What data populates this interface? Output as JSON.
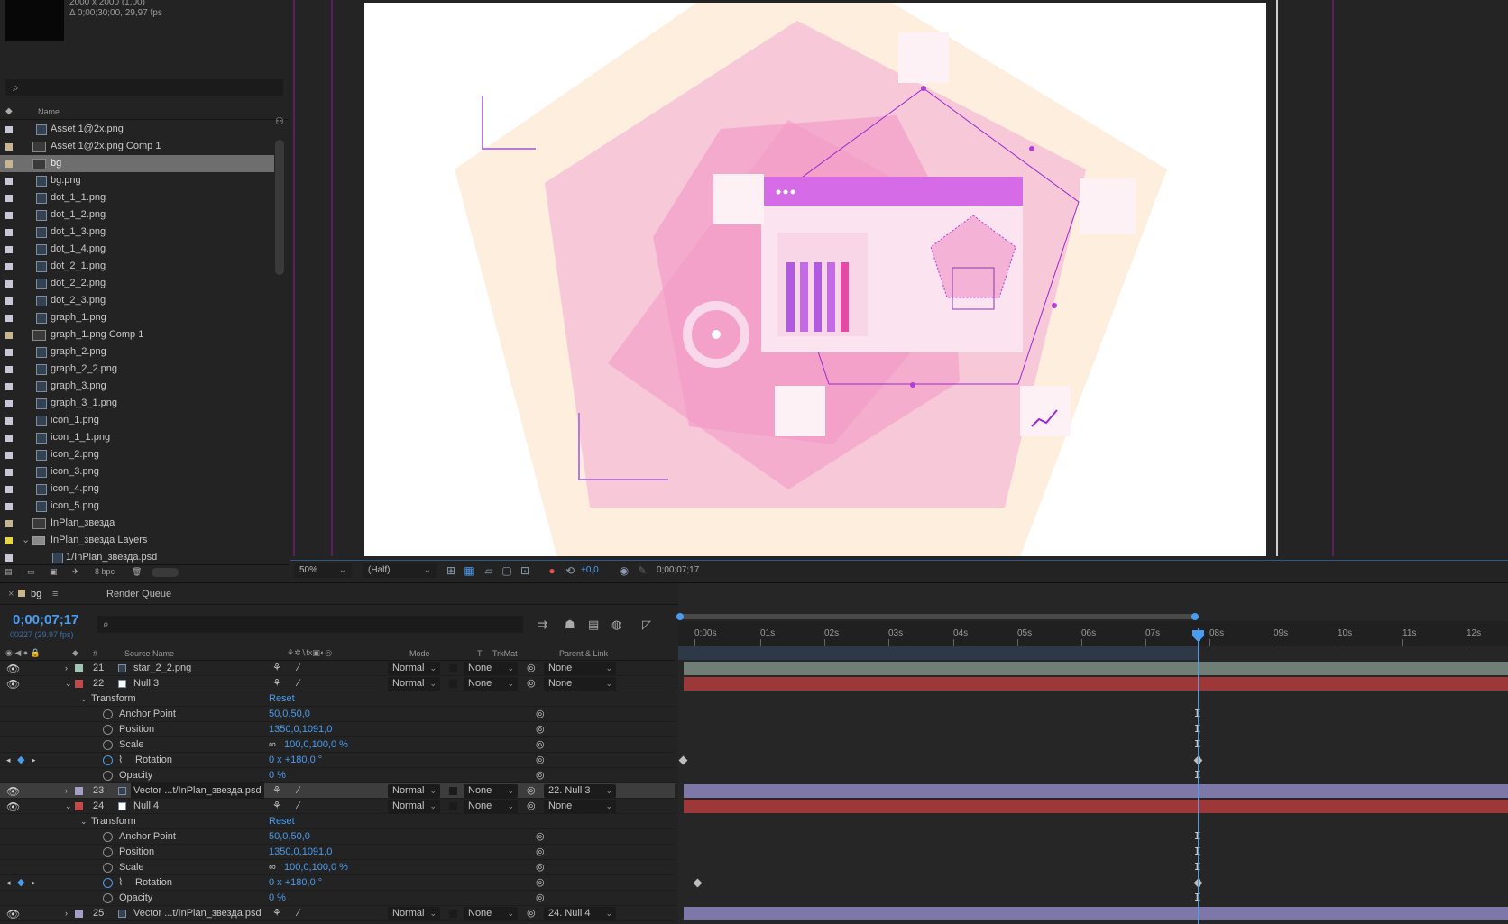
{
  "project": {
    "meta_line1": "2000 x 2000 (1,00)",
    "meta_line2": "Δ 0;00;30;00, 29,97 fps",
    "search_placeholder": "",
    "name_header": "Name",
    "bpc": "8 bpc",
    "items": [
      {
        "name": "Asset 1@2x.png",
        "type": "file",
        "label": "#c7c7d8"
      },
      {
        "name": "Asset 1@2x.png Comp 1",
        "type": "comp",
        "label": "#c8b48e"
      },
      {
        "name": "bg",
        "type": "comp",
        "label": "#c8b48e",
        "selected": true
      },
      {
        "name": "bg.png",
        "type": "file",
        "label": "#c7c7d8"
      },
      {
        "name": "dot_1_1.png",
        "type": "file",
        "label": "#c7c7d8"
      },
      {
        "name": "dot_1_2.png",
        "type": "file",
        "label": "#c7c7d8"
      },
      {
        "name": "dot_1_3.png",
        "type": "file",
        "label": "#c7c7d8"
      },
      {
        "name": "dot_1_4.png",
        "type": "file",
        "label": "#c7c7d8"
      },
      {
        "name": "dot_2_1.png",
        "type": "file",
        "label": "#c7c7d8"
      },
      {
        "name": "dot_2_2.png",
        "type": "file",
        "label": "#c7c7d8"
      },
      {
        "name": "dot_2_3.png",
        "type": "file",
        "label": "#c7c7d8"
      },
      {
        "name": "graph_1.png",
        "type": "file",
        "label": "#c7c7d8"
      },
      {
        "name": "graph_1.png Comp 1",
        "type": "comp",
        "label": "#c8b48e"
      },
      {
        "name": "graph_2.png",
        "type": "file",
        "label": "#c7c7d8"
      },
      {
        "name": "graph_2_2.png",
        "type": "file",
        "label": "#c7c7d8"
      },
      {
        "name": "graph_3.png",
        "type": "file",
        "label": "#c7c7d8"
      },
      {
        "name": "graph_3_1.png",
        "type": "file",
        "label": "#c7c7d8"
      },
      {
        "name": "icon_1.png",
        "type": "file",
        "label": "#c7c7d8"
      },
      {
        "name": "icon_1_1.png",
        "type": "file",
        "label": "#c7c7d8"
      },
      {
        "name": "icon_2.png",
        "type": "file",
        "label": "#c7c7d8"
      },
      {
        "name": "icon_3.png",
        "type": "file",
        "label": "#c7c7d8"
      },
      {
        "name": "icon_4.png",
        "type": "file",
        "label": "#c7c7d8"
      },
      {
        "name": "icon_5.png",
        "type": "file",
        "label": "#c7c7d8"
      },
      {
        "name": "InPlan_звезда",
        "type": "comp",
        "label": "#c8b48e"
      },
      {
        "name": "InPlan_звезда Layers",
        "type": "folder",
        "label": "#e6d44a"
      },
      {
        "name": "1/InPlan_звезда.psd",
        "type": "file",
        "label": "#c7c7d8",
        "indent": true
      }
    ]
  },
  "viewer": {
    "zoom": "50%",
    "resolution": "(Half)",
    "exposure": "+0,0",
    "timecode": "0;00;07;17"
  },
  "timeline": {
    "tab_comp": "bg",
    "tab_render": "Render Queue",
    "timecode": "0;00;07;17",
    "frames": "00227 (29.97 fps)",
    "col_num": "#",
    "col_source": "Source Name",
    "col_mode": "Mode",
    "col_t": "T",
    "col_trkmat": "TrkMat",
    "col_parent": "Parent & Link",
    "ruler": [
      "0:00s",
      "01s",
      "02s",
      "03s",
      "04s",
      "05s",
      "06s",
      "07s",
      "08s",
      "09s",
      "10s",
      "11s",
      "12s"
    ],
    "rows": [
      {
        "kind": "layer",
        "num": "21",
        "name": "star_2_2.png",
        "color": "#a3c3b4",
        "mode": "Normal",
        "trkmat": "None",
        "parent": "None",
        "bar": "#6f7f78",
        "icon": "file"
      },
      {
        "kind": "layer",
        "num": "22",
        "name": "Null 3",
        "color": "#c24a4a",
        "mode": "Normal",
        "trkmat": "None",
        "parent": "None",
        "bar": "#9c3838",
        "icon": "null",
        "open": true
      },
      {
        "kind": "group",
        "name": "Transform",
        "value": "Reset"
      },
      {
        "kind": "prop",
        "name": "Anchor Point",
        "value": "50,0,50,0"
      },
      {
        "kind": "prop",
        "name": "Position",
        "value": "1350,0,1091,0"
      },
      {
        "kind": "prop",
        "name": "Scale",
        "value": "100,0,100,0 %",
        "link": true
      },
      {
        "kind": "prop",
        "name": "Rotation",
        "value": "0 x +180,0 °",
        "keyed": true,
        "kf_start": 6
      },
      {
        "kind": "prop",
        "name": "Opacity",
        "value": "0 %"
      },
      {
        "kind": "layer",
        "num": "23",
        "name": "Vector ...t/InPlan_звезда.psd",
        "color": "#a59ec5",
        "mode": "Normal",
        "trkmat": "None",
        "parent": "22. Null 3",
        "bar": "#7d78a8",
        "icon": "file",
        "highlight": true
      },
      {
        "kind": "layer",
        "num": "24",
        "name": "Null 4",
        "color": "#c24a4a",
        "mode": "Normal",
        "trkmat": "None",
        "parent": "None",
        "bar": "#9c3838",
        "icon": "null",
        "open": true
      },
      {
        "kind": "group",
        "name": "Transform",
        "value": "Reset"
      },
      {
        "kind": "prop",
        "name": "Anchor Point",
        "value": "50,0,50,0"
      },
      {
        "kind": "prop",
        "name": "Position",
        "value": "1350,0,1091,0"
      },
      {
        "kind": "prop",
        "name": "Scale",
        "value": "100,0,100,0 %",
        "link": true
      },
      {
        "kind": "prop",
        "name": "Rotation",
        "value": "0 x +180,0 °",
        "keyed": true,
        "kf_start": 22
      },
      {
        "kind": "prop",
        "name": "Opacity",
        "value": "0 %"
      },
      {
        "kind": "layer",
        "num": "25",
        "name": "Vector ...t/InPlan_звезда.psd",
        "color": "#a59ec5",
        "mode": "Normal",
        "trkmat": "None",
        "parent": "24. Null 4",
        "bar": "#7d78a8",
        "icon": "file"
      }
    ]
  }
}
